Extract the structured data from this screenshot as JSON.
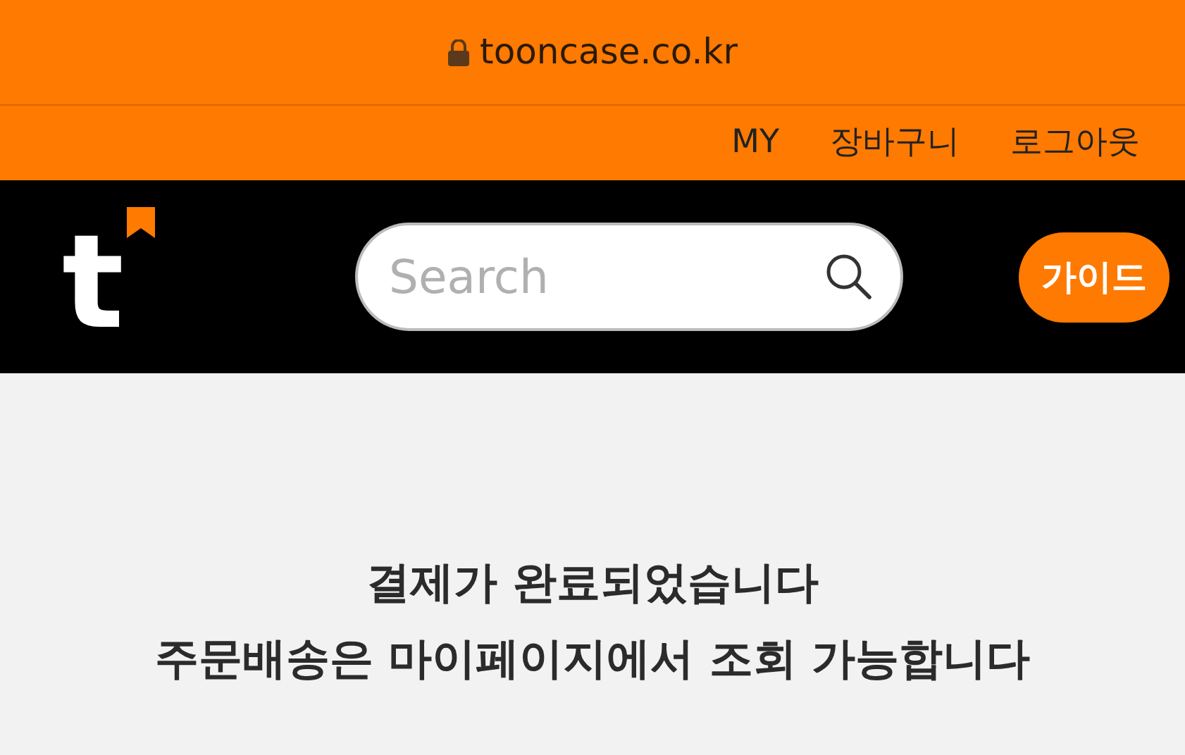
{
  "browser": {
    "url": "tooncase.co.kr"
  },
  "top_links": [
    "MY",
    "장바구니",
    "로그아웃"
  ],
  "header": {
    "logo": "t",
    "search": {
      "placeholder": "Search"
    },
    "guide_button": "가이드"
  },
  "message": [
    "결제가 완료되었습니다",
    "주문배송은 마이페이지에서 조회 가능합니다"
  ]
}
